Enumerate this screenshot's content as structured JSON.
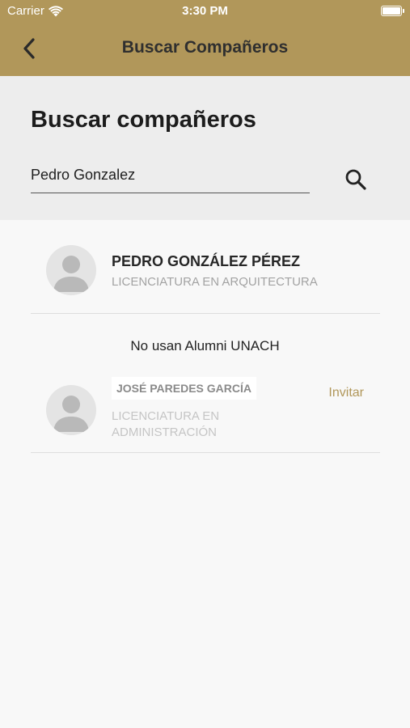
{
  "status_bar": {
    "carrier": "Carrier",
    "time": "3:30 PM",
    "icons": [
      "wifi-icon",
      "battery-icon"
    ]
  },
  "nav": {
    "title": "Buscar Compañeros",
    "back_icon": "chevron-left-icon"
  },
  "search": {
    "title": "Buscar compañeros",
    "value": "Pedro Gonzalez",
    "icon": "search-icon"
  },
  "results": [
    {
      "name": "PEDRO GONZÁLEZ PÉREZ",
      "career": "LICENCIATURA EN ARQUITECTURA"
    }
  ],
  "non_users": {
    "label": "No usan Alumni UNACH",
    "items": [
      {
        "name": "JOSÉ PAREDES GARCÍA",
        "career": "LICENCIATURA EN ADMINISTRACIÓN",
        "action": "Invitar"
      }
    ]
  },
  "colors": {
    "header": "#b1975a",
    "accent": "#b1975a",
    "background": "#f8f8f8",
    "search_bg": "#ededed"
  }
}
